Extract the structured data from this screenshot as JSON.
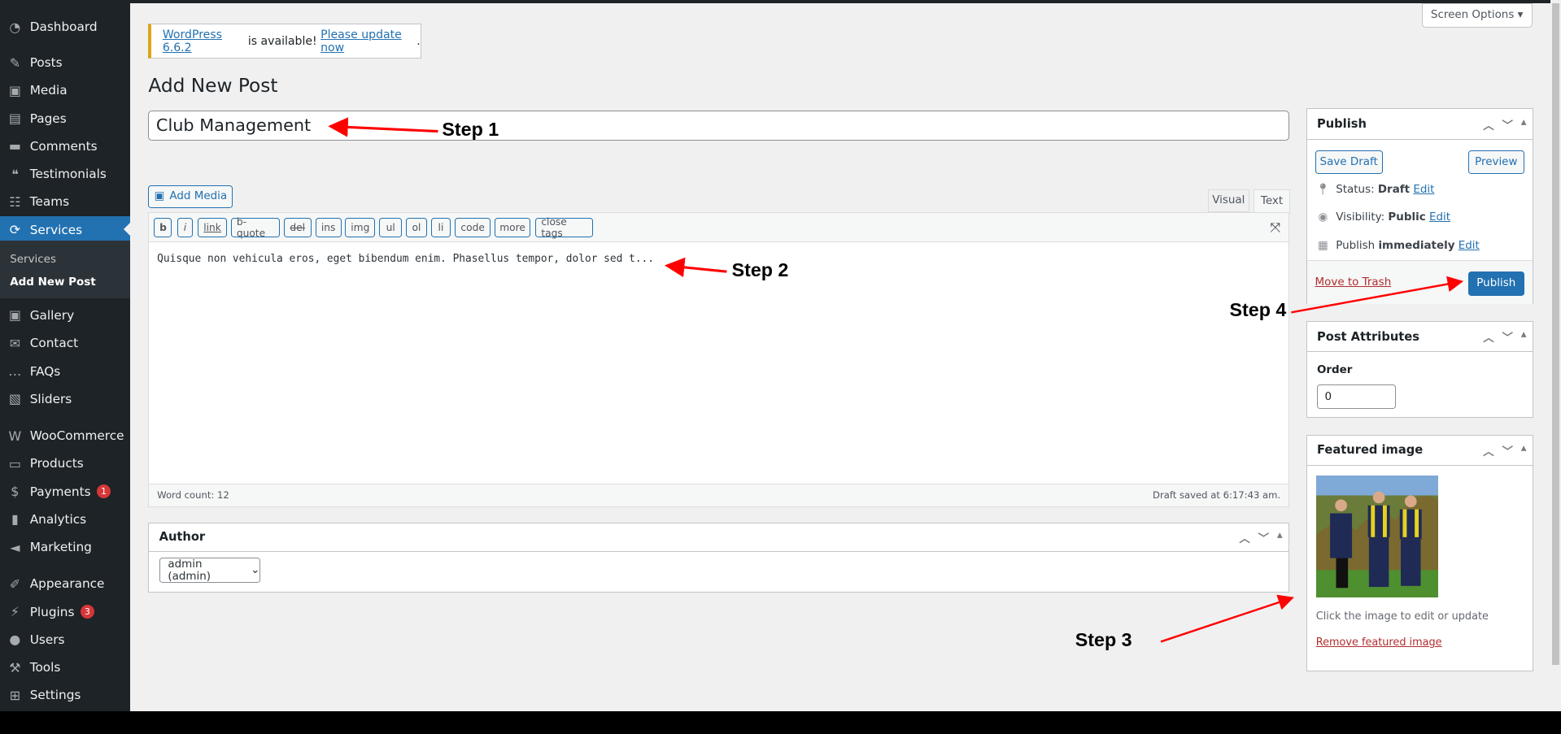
{
  "sidebar": {
    "items": [
      {
        "label": "Dashboard",
        "icon": "dashboard-icon"
      },
      {
        "label": "Posts",
        "icon": "pin-icon"
      },
      {
        "label": "Media",
        "icon": "media-icon"
      },
      {
        "label": "Pages",
        "icon": "pages-icon"
      },
      {
        "label": "Comments",
        "icon": "comment-icon"
      },
      {
        "label": "Testimonials",
        "icon": "testimonial-icon"
      },
      {
        "label": "Teams",
        "icon": "groups-icon"
      },
      {
        "label": "Services",
        "icon": "update-icon",
        "active": true
      },
      {
        "label": "Gallery",
        "icon": "media-icon"
      },
      {
        "label": "Contact",
        "icon": "email-icon"
      },
      {
        "label": "FAQs",
        "icon": "chat-icon"
      },
      {
        "label": "Sliders",
        "icon": "slides-icon"
      },
      {
        "label": "WooCommerce",
        "icon": "woo-icon"
      },
      {
        "label": "Products",
        "icon": "archive-icon"
      },
      {
        "label": "Payments",
        "icon": "money-icon",
        "badge": "1"
      },
      {
        "label": "Analytics",
        "icon": "chart-bar-icon"
      },
      {
        "label": "Marketing",
        "icon": "megaphone-icon"
      },
      {
        "label": "Appearance",
        "icon": "brush-icon"
      },
      {
        "label": "Plugins",
        "icon": "plugin-icon",
        "badge": "3"
      },
      {
        "label": "Users",
        "icon": "user-icon"
      },
      {
        "label": "Tools",
        "icon": "wrench-icon"
      },
      {
        "label": "Settings",
        "icon": "settings-icon"
      }
    ],
    "submenu": [
      "Services",
      "Add New Post"
    ]
  },
  "screen_options": "Screen Options",
  "notice": {
    "link1": "WordPress 6.6.2",
    "mid": " is available! ",
    "link2": "Please update now",
    "end": "."
  },
  "page_title": "Add New Post",
  "post_title": "Club Management",
  "add_media": "Add Media",
  "tabs": [
    "Visual",
    "Text"
  ],
  "quicktags": [
    "b",
    "i",
    "link",
    "b-quote",
    "del",
    "ins",
    "img",
    "ul",
    "ol",
    "li",
    "code",
    "more",
    "close tags"
  ],
  "content": "Quisque non vehicula eros, eget bibendum enim. Phasellus tempor, dolor sed t...",
  "word_count": "Word count: 12",
  "draft_saved": "Draft saved at 6:17:43 am.",
  "author": {
    "title": "Author",
    "value": "admin (admin)"
  },
  "publish": {
    "title": "Publish",
    "save_draft": "Save Draft",
    "preview": "Preview",
    "status_label": "Status: ",
    "status_value": "Draft",
    "visibility_label": "Visibility: ",
    "visibility_value": "Public",
    "publish_label": "Publish ",
    "publish_value": "immediately",
    "edit": "Edit",
    "trash": "Move to Trash",
    "publish_button": "Publish"
  },
  "attributes": {
    "title": "Post Attributes",
    "order_label": "Order",
    "order_value": "0"
  },
  "featured": {
    "title": "Featured image",
    "hint": "Click the image to edit or update",
    "remove": "Remove featured image"
  },
  "annotations": [
    "Step 1",
    "Step 2",
    "Step 3",
    "Step 4"
  ],
  "colors": {
    "accent": "#2271b1",
    "sidebar": "#1d2327",
    "notice": "#dba617",
    "annotation": "#ff0000",
    "danger": "#b32d2e"
  }
}
